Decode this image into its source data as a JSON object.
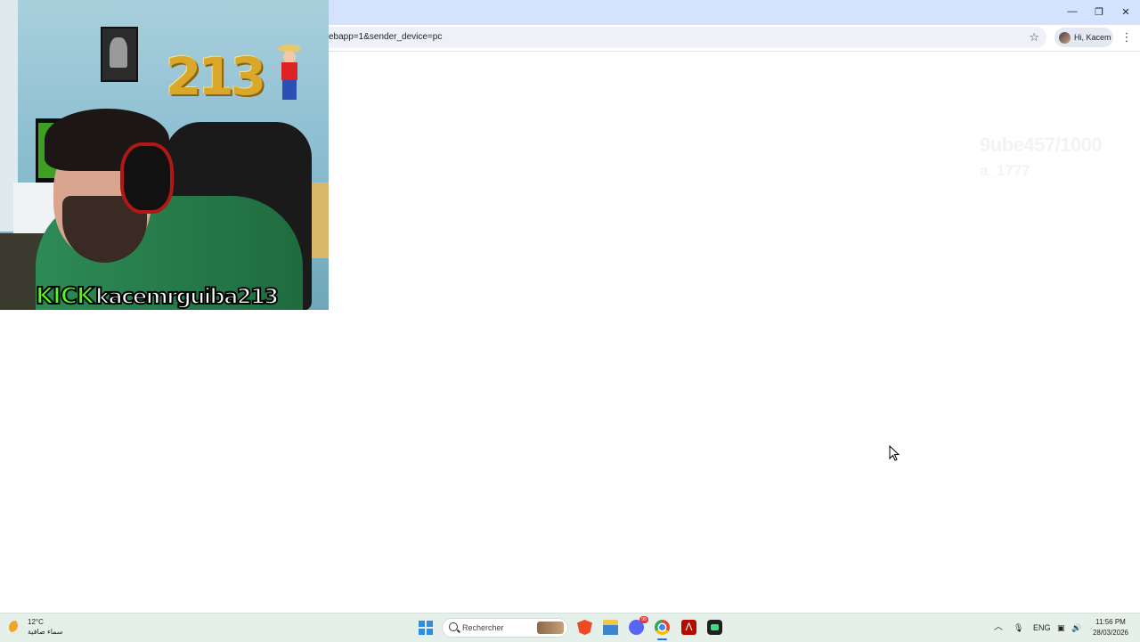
{
  "browser": {
    "url": "ebapp=1&sender_device=pc",
    "profile_label": "Hi, Kacem",
    "window_controls": {
      "minimize_icon": "minimize-icon",
      "restore_icon": "restore-icon",
      "close_icon": "close-icon"
    }
  },
  "page": {
    "ghost_line1": "9ube457/1000",
    "ghost_line2": "a_1777"
  },
  "webcam": {
    "platform": "KICK",
    "username": "kacemrguiba213",
    "balloons": "213"
  },
  "taskbar": {
    "weather_temp": "12°C",
    "weather_desc": "سماء صافية",
    "search_placeholder": "Rechercher",
    "discord_badge": "99",
    "language": "ENG",
    "time": "11:56 PM",
    "date": "28/03/2026"
  }
}
